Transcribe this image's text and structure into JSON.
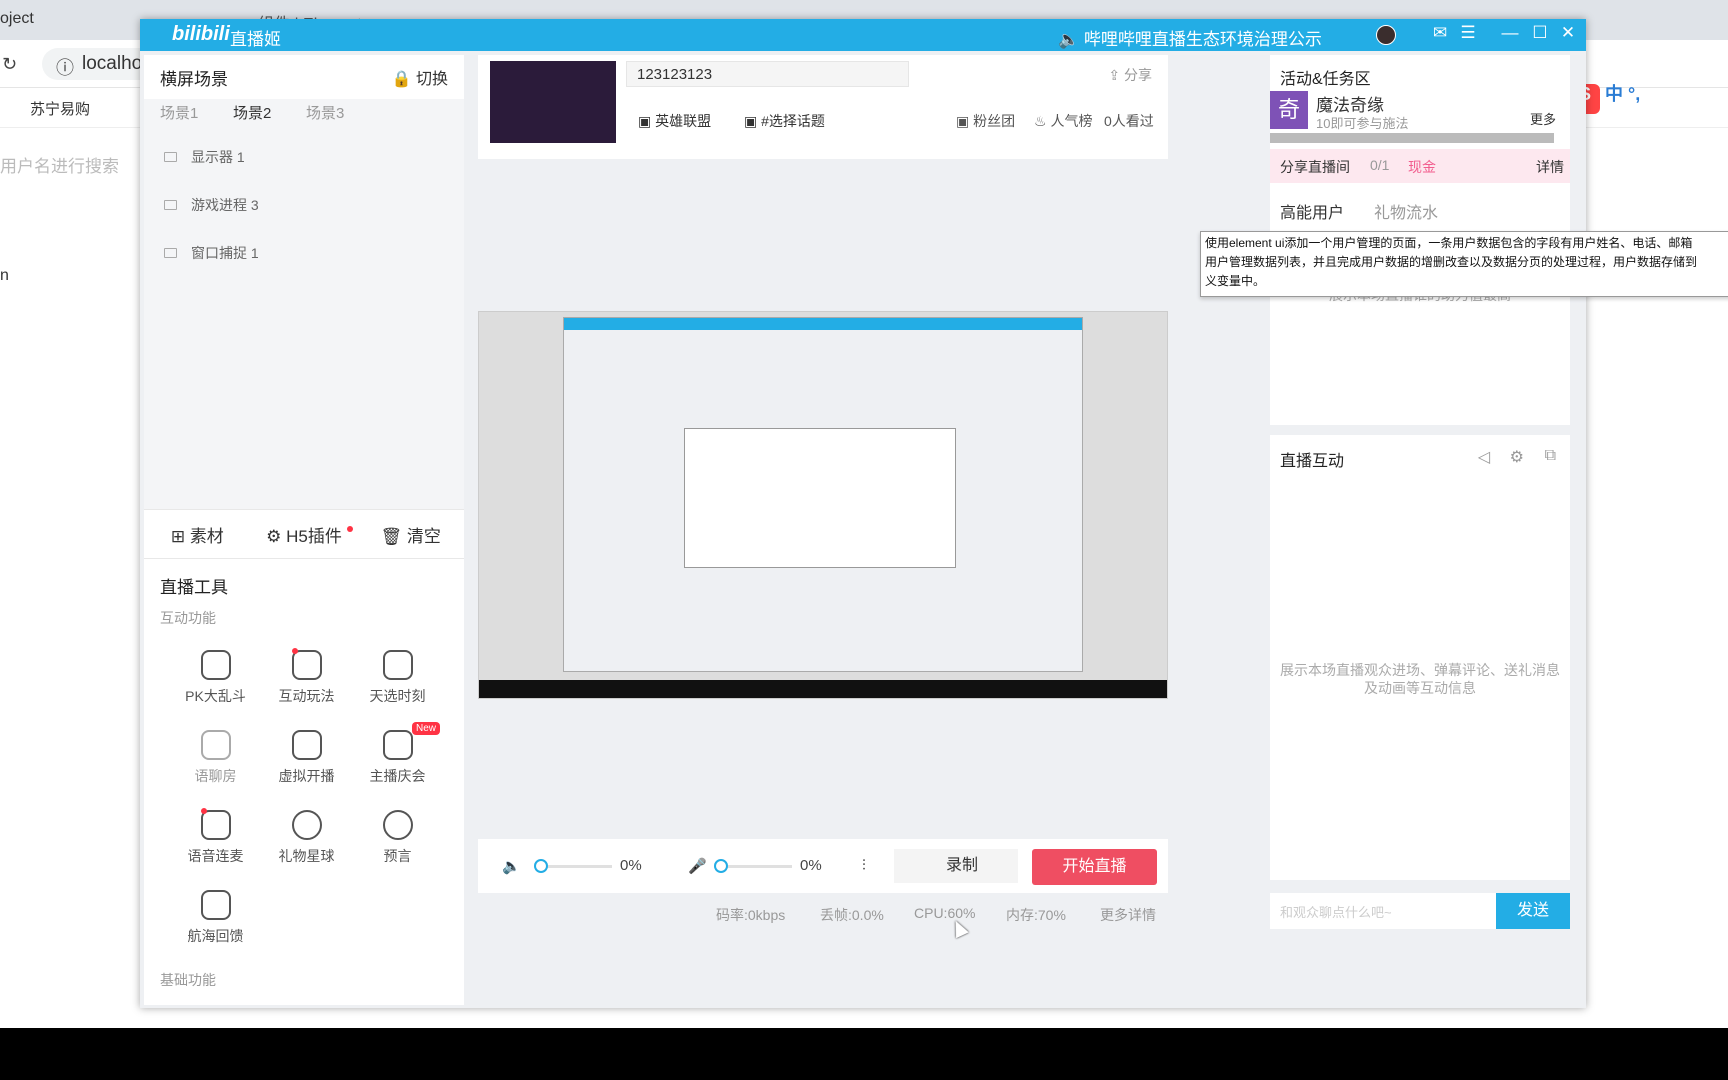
{
  "browser": {
    "tab1": "oject",
    "tab2": "组件 | Element",
    "url": "localho",
    "bookmark": "苏宁易购",
    "search_placeholder": "用户名进行搜索",
    "left_item": "n"
  },
  "app": {
    "logo": "bilibili",
    "name": "直播姬",
    "notice": "哔哩哔哩直播生态环境治理公示",
    "accent": "#23ade5"
  },
  "left": {
    "title": "横屏场景",
    "switch": "切换",
    "scenes": [
      "场景1",
      "场景2",
      "场景3"
    ],
    "sources": [
      "显示器 1",
      "游戏进程 3",
      "窗口捕捉 1"
    ],
    "tools": [
      "素材",
      "H5插件",
      "清空"
    ],
    "live_tools_title": "直播工具",
    "interactive_label": "互动功能",
    "items": [
      {
        "label": "PK大乱斗",
        "icon": "pk-icon"
      },
      {
        "label": "互动玩法",
        "icon": "interactive-play-icon"
      },
      {
        "label": "天选时刻",
        "icon": "lucky-time-icon"
      },
      {
        "label": "语聊房",
        "icon": "voice-room-icon"
      },
      {
        "label": "虚拟开播",
        "icon": "virtual-live-icon"
      },
      {
        "label": "主播庆会",
        "icon": "celebration-icon"
      },
      {
        "label": "语音连麦",
        "icon": "voice-mic-icon"
      },
      {
        "label": "礼物星球",
        "icon": "gift-planet-icon"
      },
      {
        "label": "预言",
        "icon": "prophecy-icon"
      },
      {
        "label": "航海回馈",
        "icon": "anchor-icon"
      }
    ],
    "new_badge": "New",
    "basic_label": "基础功能"
  },
  "center": {
    "title_value": "123123123",
    "share": "分享",
    "category": "英雄联盟",
    "topic": "#选择话题",
    "fans": "粉丝团",
    "popularity": "人气榜",
    "watched": "0人看过",
    "volume": "0%",
    "mic": "0%",
    "record": "录制",
    "start": "开始直播",
    "status": {
      "bitrate": "码率:0kbps",
      "drop": "丢帧:0.0%",
      "cpu": "CPU:60%",
      "mem": "内存:70%",
      "more": "更多详情"
    }
  },
  "right": {
    "activity_title": "活动&任务区",
    "activity_name": "魔法奇缘",
    "activity_desc": "10即可参与施法",
    "activity_icon": "奇",
    "more": "更多",
    "share_room": "分享直播间",
    "share_progress": "0/1",
    "share_reward": "现金",
    "detail": "详情",
    "hidden_row": "高能用户",
    "hidden_row2": "礼物流水",
    "boost_text": "展示本场直播谁的助力值最高",
    "interact_title": "直播互动",
    "interact_text": "展示本场直播观众进场、弹幕评论、送礼消息及动画等互动信息",
    "chat_placeholder": "和观众聊点什么吧~",
    "send": "发送"
  },
  "tooltip": {
    "line1": "使用element ui添加一个用户管理的页面，一条用户数据包含的字段有用户姓名、电话、邮箱",
    "line2": "用户管理数据列表，并且完成用户数据的增删改查以及数据分页的处理过程，用户数据存储到",
    "line3": "义变量中。"
  },
  "ime": {
    "label": "中 °,"
  }
}
